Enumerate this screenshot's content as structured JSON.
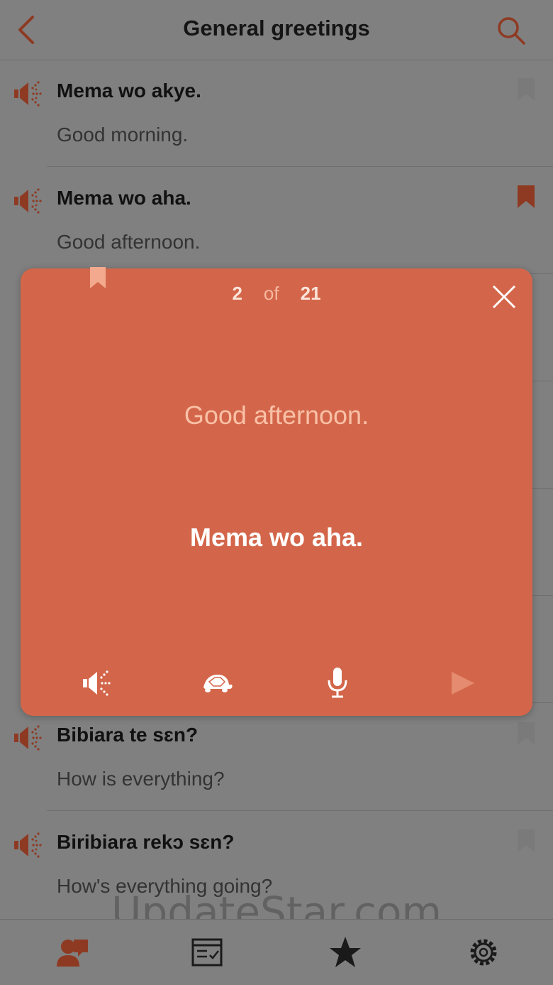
{
  "header": {
    "title": "General greetings",
    "back_icon": "chevron-left-icon",
    "search_icon": "search-icon"
  },
  "list": [
    {
      "phrase": "Mema wo akye.",
      "translation": "Good morning.",
      "bookmarked": false
    },
    {
      "phrase": "Mema wo aha.",
      "translation": "Good afternoon.",
      "bookmarked": true
    },
    {
      "phrase": "Bibiara te sɛn?",
      "translation": "How is everything?",
      "bookmarked": false
    },
    {
      "phrase": "Biribiara rekɔ sɛn?",
      "translation": "How's everything going?",
      "bookmarked": false
    }
  ],
  "card": {
    "current": "2",
    "of_label": "of",
    "total": "21",
    "translation": "Good afternoon.",
    "phrase": "Mema wo aha.",
    "controls": [
      "speaker-icon",
      "turtle-slow-icon",
      "microphone-icon",
      "play-icon"
    ]
  },
  "tabbar": {
    "tabs": [
      "phrasebook-icon",
      "quiz-icon",
      "favorites-star-icon",
      "settings-gear-icon"
    ]
  },
  "watermark": "UpdateStar.com",
  "colors": {
    "accent": "#c4512f",
    "card": "#d3664a",
    "dim_background": "#808080"
  }
}
